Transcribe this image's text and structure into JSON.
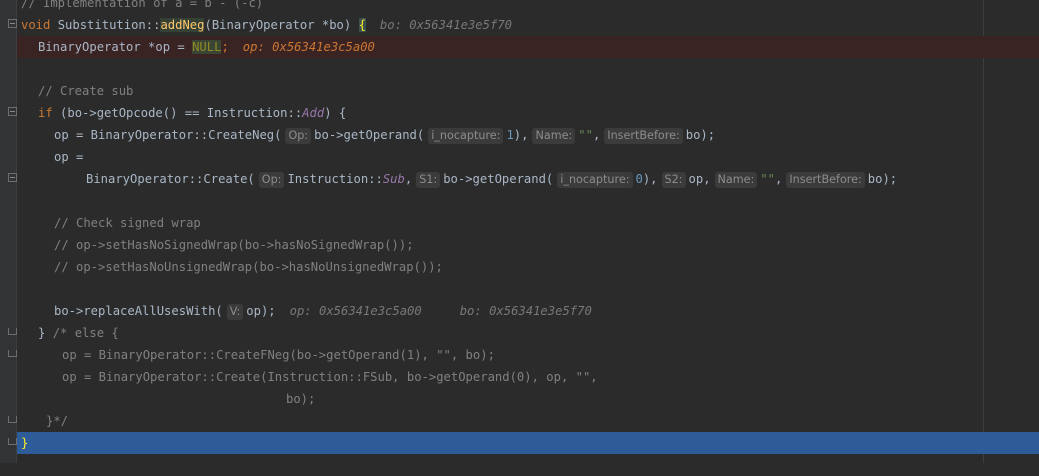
{
  "editor": {
    "lines": {
      "l0": "// Implementation of a = b - (-c)",
      "l1_kw": "void",
      "l1_cls": "Substitution",
      "l1_sep": "::",
      "l1_fn": "addNeg",
      "l1_rest": "(BinaryOperator *bo) ",
      "l1_brace": "{",
      "l1_dbg": "bo: 0x56341e3e5f70",
      "l2_a": "BinaryOperator *op = ",
      "l2_null": "NULL",
      "l2_b": ";",
      "l2_dbg": "op: 0x56341e3c5a00",
      "l4": "// Create sub",
      "l5_kw": "if",
      "l5_a": " (bo->getOpcode() == Instruction::",
      "l5_enum": "Add",
      "l5_b": ") {",
      "l6_a": "op = BinaryOperator::CreateNeg(",
      "l6_h1": "Op:",
      "l6_b": "bo->getOperand(",
      "l6_h2": "i_nocapture:",
      "l6_num": "1",
      "l6_c": "),",
      "l6_h3": "Name:",
      "l6_str": "\"\"",
      "l6_d": ",",
      "l6_h4": "InsertBefore:",
      "l6_e": "bo);",
      "l7": "op =",
      "l8_a": "BinaryOperator::Create(",
      "l8_h1": "Op:",
      "l8_b": "Instruction::",
      "l8_enum": "Sub",
      "l8_c": ",",
      "l8_h2": "S1:",
      "l8_d": "bo->getOperand(",
      "l8_h3": "i_nocapture:",
      "l8_num": "0",
      "l8_e": "),",
      "l8_h4": "S2:",
      "l8_f": "op,",
      "l8_h5": "Name:",
      "l8_str": "\"\"",
      "l8_g": ",",
      "l8_h6": "InsertBefore:",
      "l8_h": "bo);",
      "l10": "// Check signed wrap",
      "l11": "// op->setHasNoSignedWrap(bo->hasNoSignedWrap());",
      "l12": "// op->setHasNoUnsignedWrap(bo->hasNoUnsignedWrap());",
      "l14_a": "bo->replaceAllUsesWith(",
      "l14_h1": "V:",
      "l14_b": "op);",
      "l14_dbg1": "op: 0x56341e3c5a00",
      "l14_dbg2": "bo: 0x56341e3e5f70",
      "l15_a": "} ",
      "l15_cm": "/* else {",
      "l16": "op = BinaryOperator::CreateFNeg(bo->getOperand(1), \"\", bo);",
      "l17": "op = BinaryOperator::Create(Instruction::FSub, bo->getOperand(0), op, \"\",",
      "l18": "bo);",
      "l19": "}*/",
      "l20": "}"
    }
  }
}
